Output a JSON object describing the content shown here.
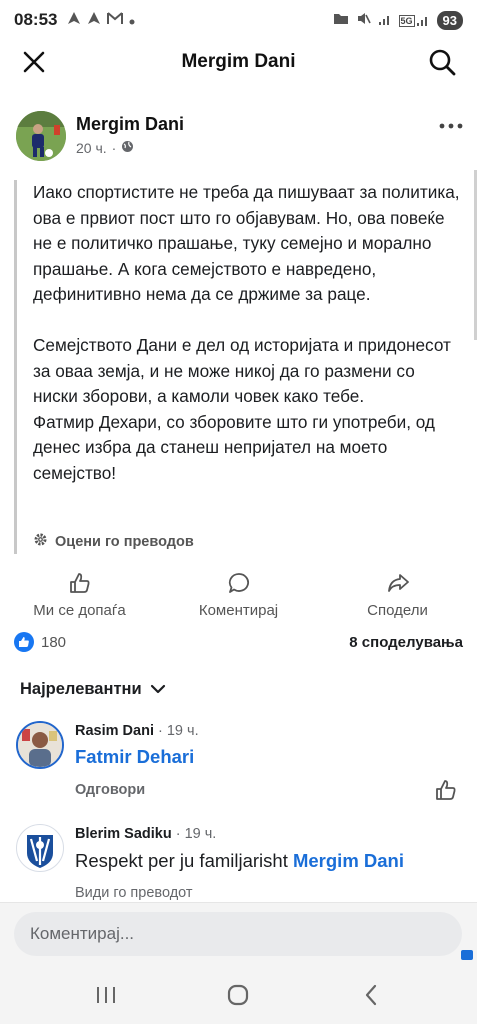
{
  "status_bar": {
    "time": "08:53",
    "left_icons": [
      "navigation-arrow-icon",
      "navigation-arrow-icon",
      "gmail-icon",
      "dot-icon"
    ],
    "right_icons": [
      "folder-icon",
      "mute-icon",
      "signal-icon",
      "5g-signal-icon"
    ],
    "network_badge": "5G",
    "battery": "93"
  },
  "header": {
    "title": "Mergim Dani",
    "close_icon": "close-icon",
    "search_icon": "search-icon"
  },
  "post": {
    "author": "Mergim Dani",
    "time": "20 ч.",
    "separator": "·",
    "privacy_icon": "globe-icon",
    "text": "Иако спортистите не треба да пишуваат за политика, ова е првиот пост што го објавувам. Но, ова повеќе не е политичко прашање, туку семејно и морално прашање. А кога семејството е навредено, дефинитивно нема да се држиме за раце.\n\nСемејството Дани е дел од историјата и придонесот за оваа земја, и не може никој да го размени со ниски зборови, а камоли човек како тебе.\nФатмир Дехари, со зборовите што ги употреби, од денес избра да станеш непријател на моето семејство!",
    "translate_label": "Оцени го преводов"
  },
  "actions": {
    "like": "Ми се допаѓа",
    "comment": "Коментирај",
    "share": "Сподели"
  },
  "reactions": {
    "count": "180",
    "shares": "8 споделувања"
  },
  "filter": {
    "label": "Најрелевантни"
  },
  "comments": [
    {
      "author": "Rasim Dani",
      "time": "· 19 ч.",
      "text_prefix": "",
      "mention": "Fatmir Dehari",
      "reply_label": "Одговори"
    },
    {
      "author": "Blerim Sadiku",
      "time": "· 19 ч.",
      "text_prefix": "Respekt per ju familjarisht ",
      "mention": "Mergim Dani",
      "translate_label": "Види го преводот"
    }
  ],
  "composer": {
    "placeholder": "Коментирај..."
  },
  "colors": {
    "accent": "#1877f2",
    "mention": "#1a6ed8",
    "secondary_text": "#65676b"
  }
}
